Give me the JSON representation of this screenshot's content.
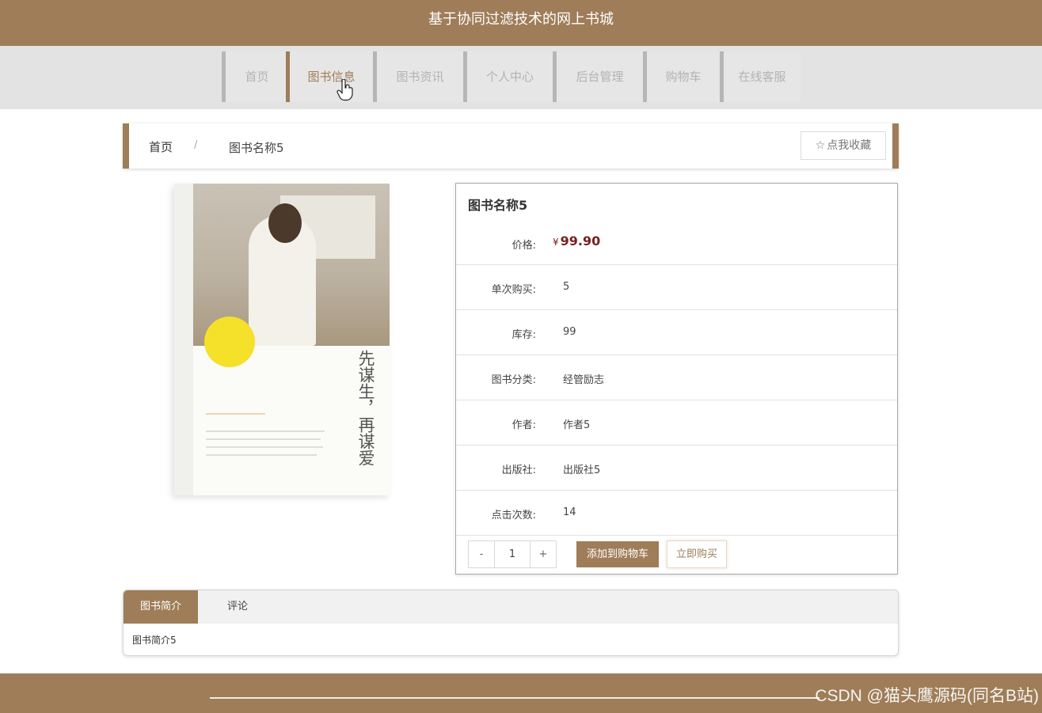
{
  "site": {
    "title": "基于协同过滤技术的网上书城"
  },
  "nav": {
    "items": [
      {
        "label": "首页"
      },
      {
        "label": "图书信息"
      },
      {
        "label": "图书资讯"
      },
      {
        "label": "个人中心"
      },
      {
        "label": "后台管理"
      },
      {
        "label": "购物车"
      },
      {
        "label": "在线客服"
      }
    ],
    "active": "图书信息"
  },
  "breadcrumb": {
    "home": "首页",
    "separator": "/",
    "current": "图书名称5"
  },
  "favorite": {
    "label": "点我收藏",
    "icon": "star-outline-icon"
  },
  "book": {
    "title": "图书名称5",
    "price_label": "价格:",
    "currency": "¥",
    "price": "99.90",
    "rows": [
      {
        "label": "单次购买:",
        "value": "5"
      },
      {
        "label": "库存:",
        "value": "99"
      },
      {
        "label": "图书分类:",
        "value": "经管励志"
      },
      {
        "label": "作者:",
        "value": "作者5"
      },
      {
        "label": "出版社:",
        "value": "出版社5"
      },
      {
        "label": "点击次数:",
        "value": "14"
      }
    ],
    "cover": {
      "title_text": "先谋生，再谋爱"
    }
  },
  "purchase": {
    "minus": "-",
    "plus": "+",
    "quantity": "1",
    "add_to_cart": "添加到购物车",
    "buy_now": "立即购买"
  },
  "tabs": {
    "items": [
      {
        "label": "图书简介"
      },
      {
        "label": "评论"
      }
    ],
    "active": "图书简介",
    "content": "图书简介5"
  },
  "watermark": "CSDN @猫头鹰源码(同名B站)",
  "colors": {
    "brand": "#9e7d58",
    "price": "#7a1f1f",
    "nav_bg": "#e3e3e3"
  }
}
